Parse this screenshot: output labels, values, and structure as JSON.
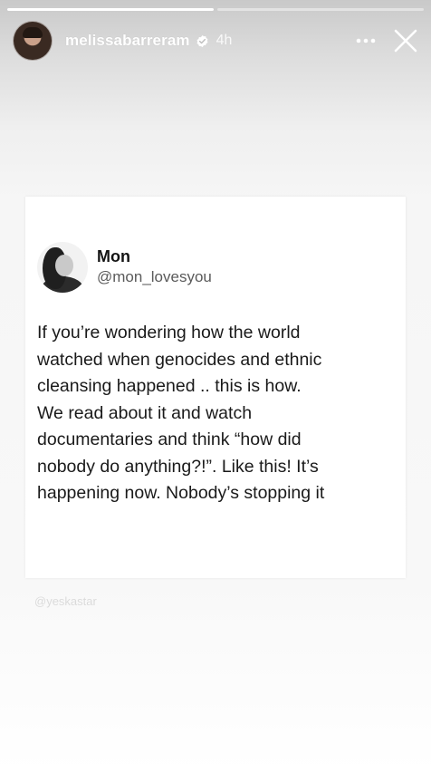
{
  "story": {
    "progress": [
      1,
      0
    ],
    "username": "melissabarreram",
    "verified_icon": "verified-badge-icon",
    "time": "4h",
    "more_icon": "more-options-icon",
    "close_icon": "close-icon"
  },
  "tweet": {
    "display_name": "Mon",
    "handle": "@mon_lovesyou",
    "text": "If you’re wondering how the world\nwatched when genocides and ethnic\ncleansing happened .. this is how.\nWe read about it and watch\ndocumentaries and think “how did\nnobody do anything?!”. Like this! It’s\nhappening now. Nobody’s stopping it"
  },
  "watermark": "@yeskastar",
  "colors": {
    "verified": "#ffffff",
    "text": "#1a1a1a",
    "handle": "#5b5b5b"
  }
}
